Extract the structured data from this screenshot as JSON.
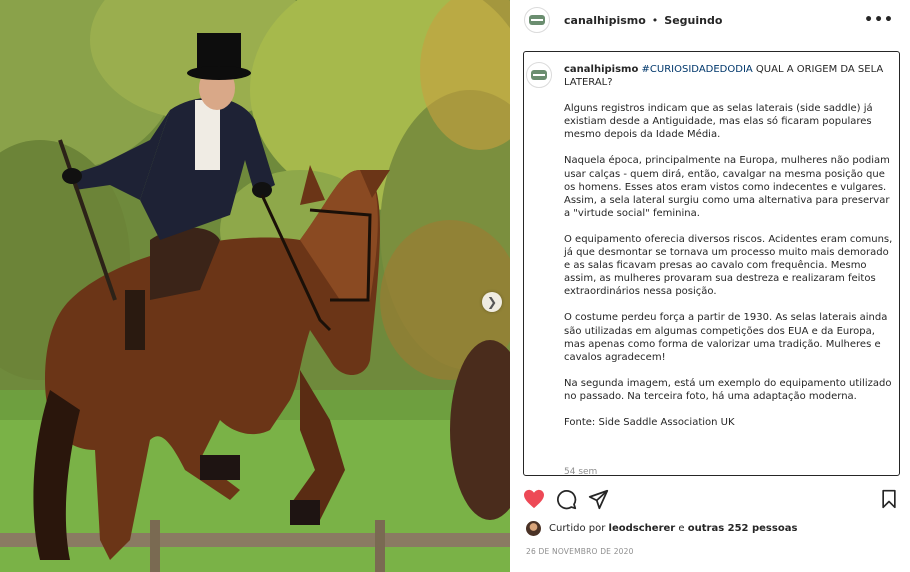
{
  "post": {
    "username": "canalhipismo",
    "separator": "•",
    "follow_status": "Seguindo",
    "caption": {
      "username": "canalhipismo",
      "hashtag": "#CURIOSIDADEDODIA",
      "title": " QUAL A ORIGEM DA SELA LATERAL?",
      "paragraphs": [
        "Alguns registros indicam que as selas laterais (side saddle) já existiam desde a Antiguidade, mas elas só ficaram populares mesmo depois da Idade Média.",
        "Naquela época, principalmente na Europa, mulheres não podiam usar calças - quem dirá, então, cavalgar na mesma posição que os homens. Esses atos eram vistos como indecentes e vulgares. Assim, a sela lateral surgiu como uma alternativa para preservar a \"virtude social\" feminina.",
        "O equipamento oferecia diversos riscos. Acidentes eram comuns, já que desmontar se tornava um processo muito mais demorado e as salas ficavam presas ao cavalo com frequência. Mesmo assim, as mulheres provaram sua destreza e realizaram feitos extraordinários nessa posição.",
        "O costume perdeu força a partir de 1930. As selas laterais ainda são utilizadas em algumas competições dos EUA e da Europa, mas apenas como forma de valorizar uma tradição. Mulheres e cavalos agradecem!",
        "Na segunda imagem, está um exemplo do equipamento utilizado no passado. Na terceira foto, há uma adaptação moderna.",
        "Fonte: Side Saddle Association UK"
      ],
      "time": "54 sem"
    },
    "likes": {
      "prefix": "Curtido por ",
      "user": "leodscherer",
      "middle": " e ",
      "others": "outras 252 pessoas"
    },
    "date": "26 DE NOVEMBRO DE 2020",
    "icons": {
      "like": "heart-icon",
      "comment": "comment-icon",
      "share": "share-icon",
      "save": "bookmark-icon",
      "more": "more-options-icon",
      "next": "chevron-right-icon"
    },
    "colors": {
      "like_red": "#ed4956",
      "hashtag_blue": "#00376b",
      "muted": "#8e8e8e"
    }
  }
}
